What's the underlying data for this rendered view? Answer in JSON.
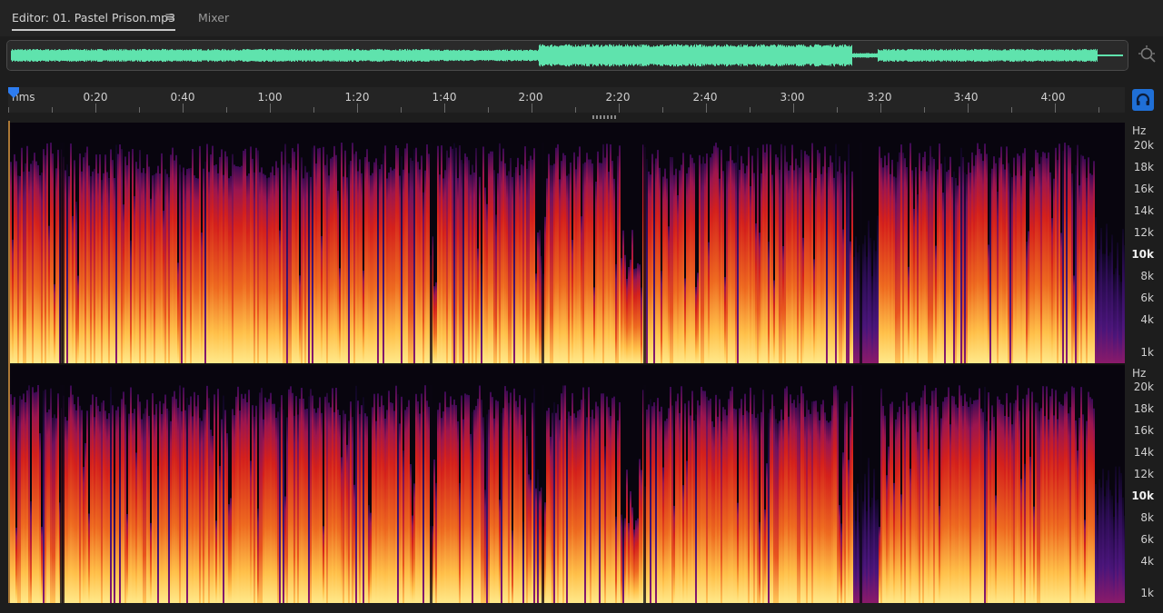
{
  "tabs": {
    "editor_label": "Editor: 01. Pastel Prison.mp3",
    "mixer_label": "Mixer"
  },
  "icons": {
    "tab_menu": "hamburger-menu-icon",
    "zoom": "zoom-to-selection-icon",
    "headphones": "headphones-icon",
    "playhead": "playhead-marker-icon"
  },
  "ruler": {
    "unit": "hms",
    "labels": [
      "0:20",
      "0:40",
      "1:00",
      "1:20",
      "1:40",
      "2:00",
      "2:20",
      "2:40",
      "3:00",
      "3:20",
      "3:40",
      "4:00"
    ]
  },
  "frequency_axis": {
    "unit": "Hz",
    "labels": [
      "20k",
      "18k",
      "16k",
      "14k",
      "12k",
      "10k",
      "8k",
      "6k",
      "4k",
      "1k"
    ]
  },
  "colors": {
    "waveform": "#5fe3ad",
    "accent_blue": "#1f6fd6",
    "spectral_low": "#1a0a3a",
    "spectral_mid": "#d4201c",
    "spectral_high": "#ffd55a"
  }
}
